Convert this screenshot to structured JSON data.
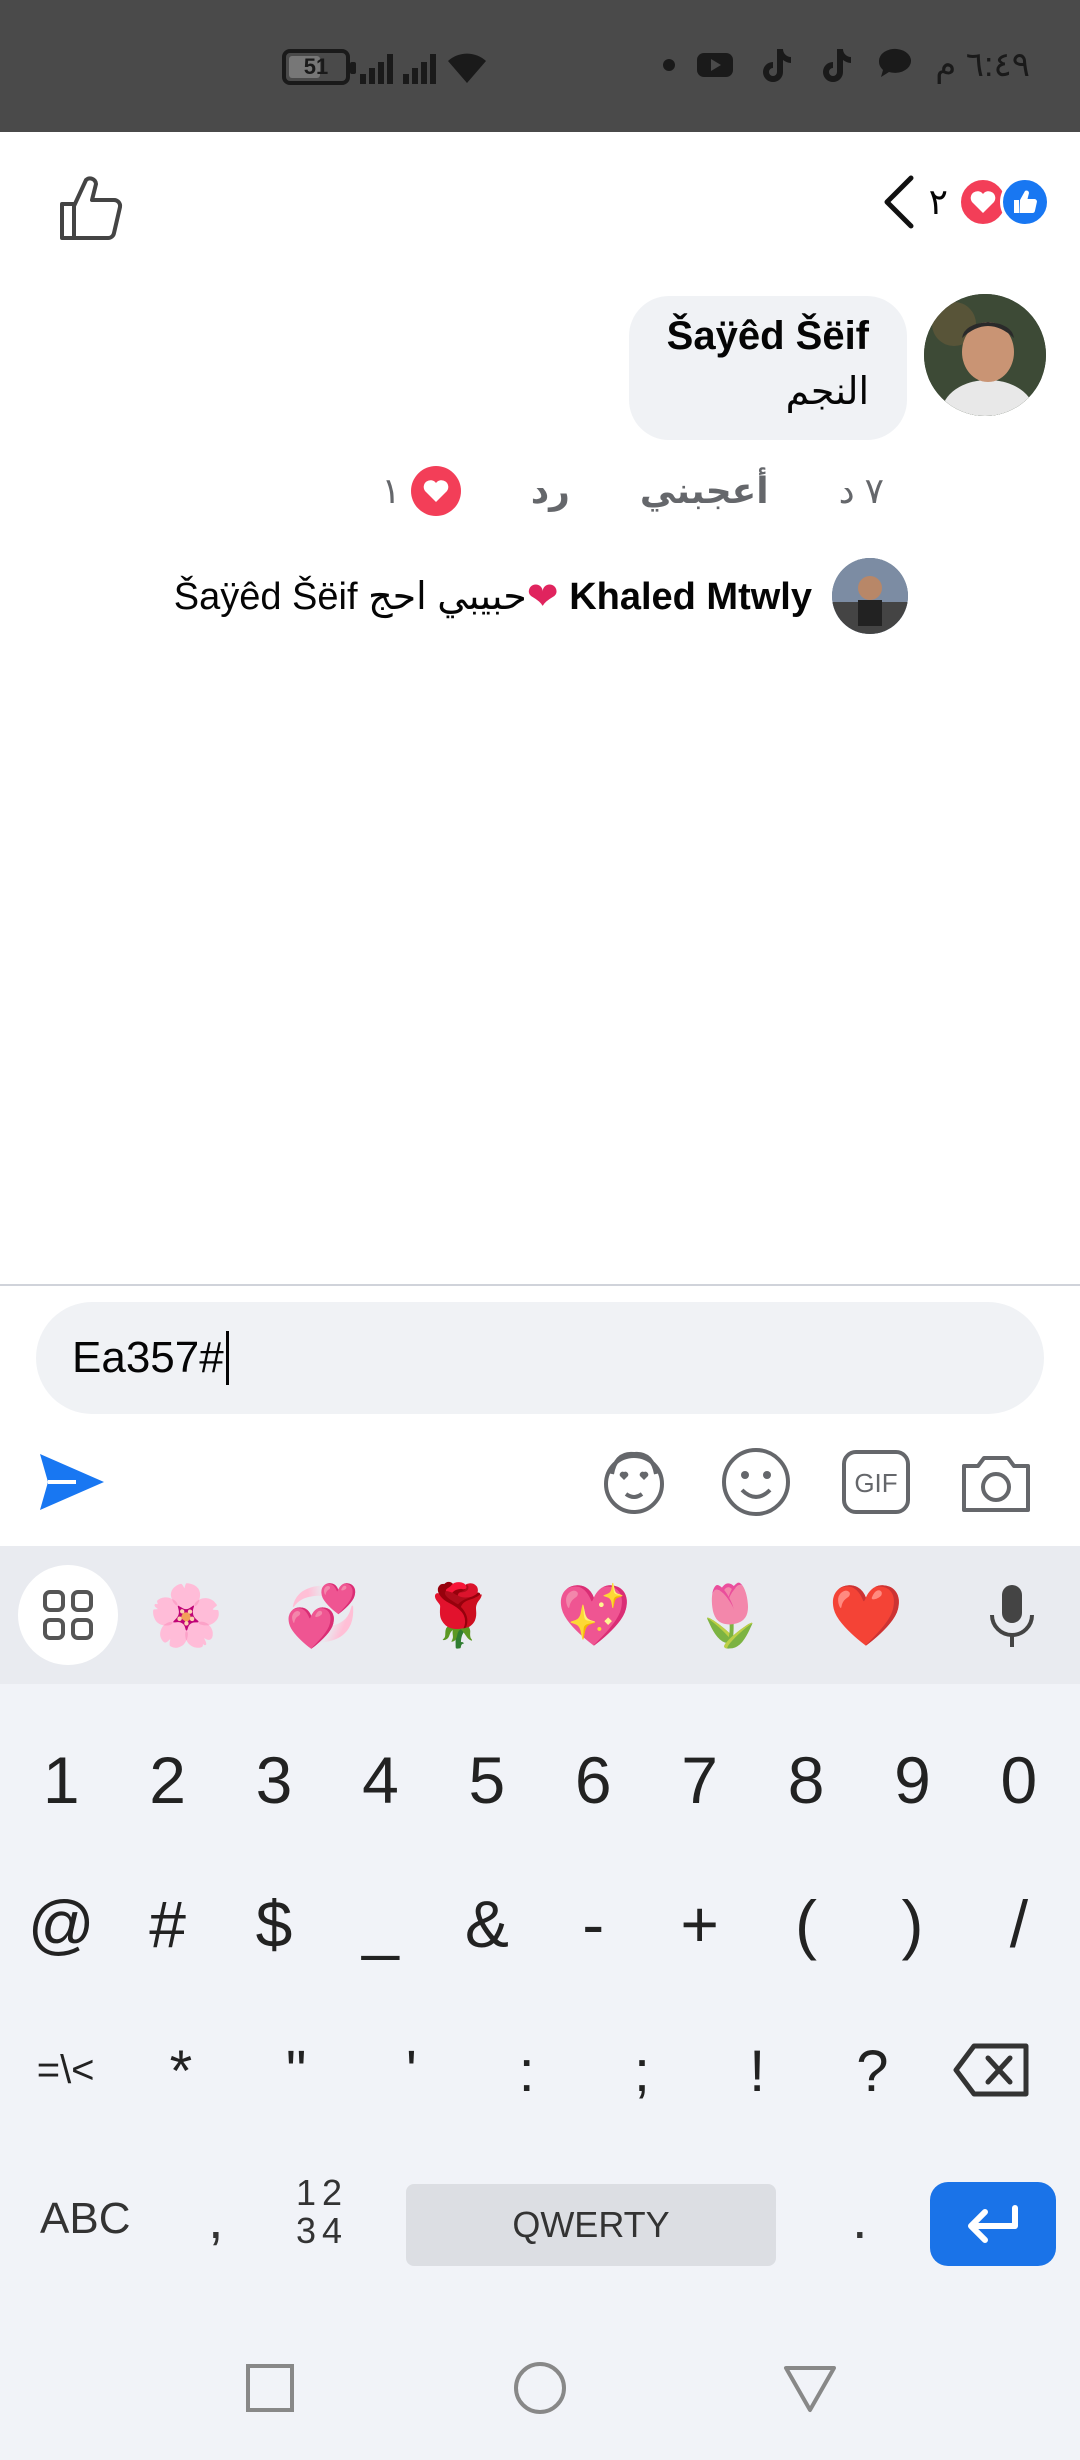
{
  "status_bar": {
    "time": "٦:٤٩ م",
    "battery": "51"
  },
  "header": {
    "reaction_count": "٢"
  },
  "comment": {
    "author": "Šaÿêd Šëif",
    "text": "النجم",
    "time": "٧ د",
    "like_label": "أعجبني",
    "reply_label": "رد",
    "reaction_count": "١"
  },
  "reply_preview": {
    "author": "Khaled Mtwly",
    "text": "حبيبي احج",
    "mention": "Šaÿêd Šëif"
  },
  "composer": {
    "value": "Ea357#"
  },
  "keyboard": {
    "suggestions": [
      "🌸",
      "💞",
      "🌹",
      "💖",
      "🌷",
      "❤️"
    ],
    "row1": [
      "1",
      "2",
      "3",
      "4",
      "5",
      "6",
      "7",
      "8",
      "9",
      "0"
    ],
    "row2": [
      "@",
      "#",
      "$",
      "_",
      "&",
      "-",
      "+",
      "(",
      ")",
      "/"
    ],
    "row3": [
      "=\\<",
      "*",
      "\"",
      "'",
      ":",
      ";",
      "!",
      "?"
    ],
    "abc": "ABC",
    "comma": ",",
    "num_top": "12",
    "num_bottom": "34",
    "space": "QWERTY",
    "dot": "."
  },
  "colors": {
    "brand_blue": "#1877f2",
    "heart_red": "#f33e58",
    "enter_blue": "#1a73e8"
  }
}
